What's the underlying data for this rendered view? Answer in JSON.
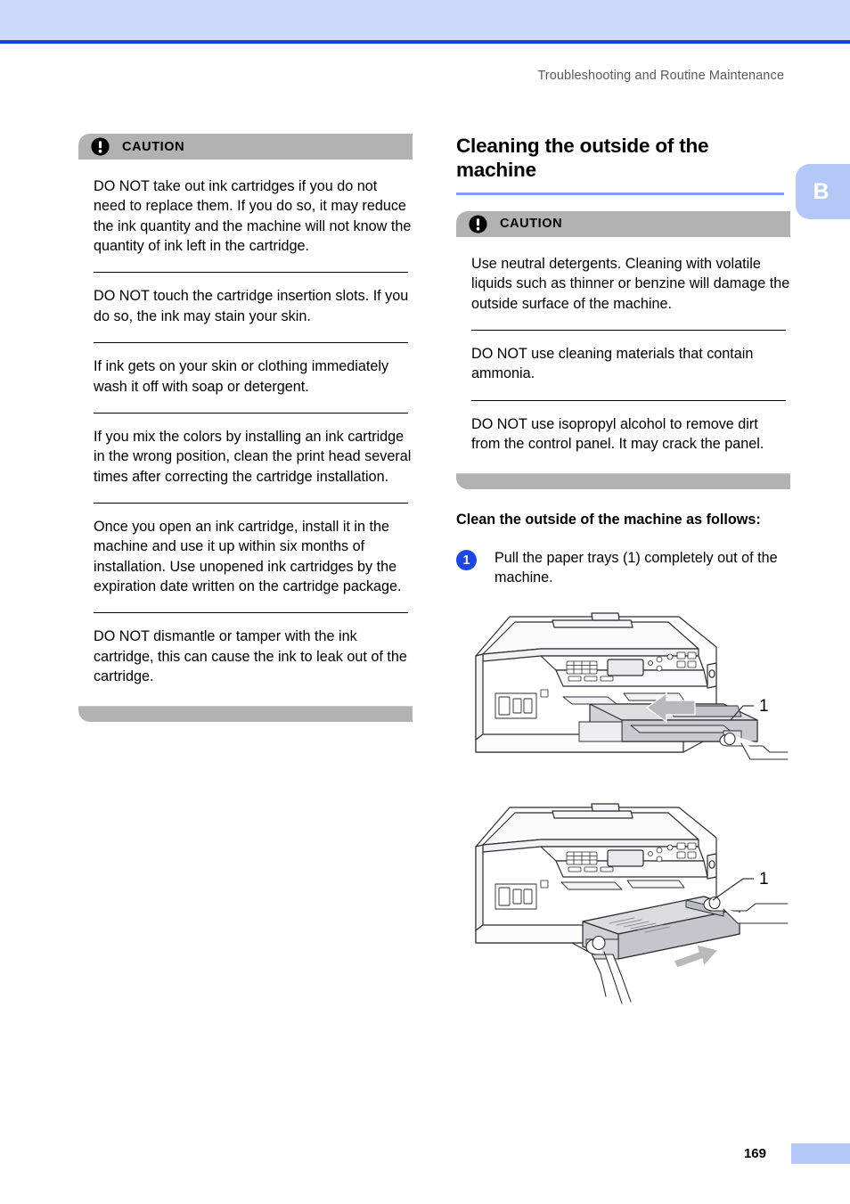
{
  "page": {
    "running_header": "Troubleshooting and Routine Maintenance",
    "chapter_tab": "B",
    "folio": "169",
    "accent_band_color": "#ccd9fb",
    "accent_rule_color": "#0645e0",
    "heading_rule_color": "#7e9fea",
    "caution_bar_color": "#b2b2b2",
    "step_badge_color": "#1b46e8"
  },
  "left_column": {
    "caution": {
      "icon": "exclamation-circle-icon",
      "label": "CAUTION",
      "paragraphs": [
        "DO NOT take out ink cartridges if you do not need to replace them. If you do so, it may reduce the ink quantity and the machine will not know the quantity of ink left in the cartridge.",
        "DO NOT touch the cartridge insertion slots. If you do so, the ink may stain your skin.",
        "If ink gets on your skin or clothing immediately wash it off with soap or detergent.",
        "If you mix the colors by installing an ink cartridge in the wrong position, clean the print head several times after correcting the cartridge installation.",
        "Once you open an ink cartridge, install it in the machine and use it up within six months of installation. Use unopened ink cartridges by the expiration date written on the cartridge package.",
        "DO NOT dismantle or tamper with the ink cartridge, this can cause the ink to leak out of the cartridge."
      ]
    }
  },
  "right_column": {
    "heading": "Cleaning the outside of the machine",
    "caution": {
      "icon": "exclamation-circle-icon",
      "label": "CAUTION",
      "paragraphs": [
        "Use neutral detergents. Cleaning with volatile liquids such as thinner or benzine will damage the outside surface of the machine.",
        "DO NOT use cleaning materials that contain ammonia.",
        "DO NOT use isopropyl alcohol to remove dirt from the control panel. It may crack the panel."
      ]
    },
    "lead_in": "Clean the outside of the machine as follows:",
    "steps": [
      {
        "number": "1",
        "text": "Pull the paper trays (1) completely out of the machine."
      }
    ],
    "figures": [
      {
        "name": "printer-paper-tray-upper-figure",
        "callout": "1"
      },
      {
        "name": "printer-paper-tray-lower-figure",
        "callout": "1"
      }
    ]
  }
}
